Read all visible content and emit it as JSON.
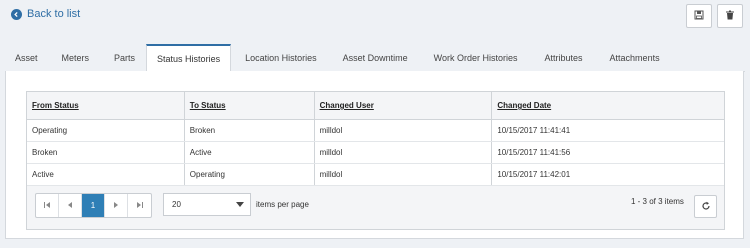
{
  "back_link": {
    "label": "Back to list"
  },
  "tabs": [
    {
      "label": "Asset"
    },
    {
      "label": "Meters"
    },
    {
      "label": "Parts"
    },
    {
      "label": "Status Histories"
    },
    {
      "label": "Location Histories"
    },
    {
      "label": "Asset Downtime"
    },
    {
      "label": "Work Order Histories"
    },
    {
      "label": "Attributes"
    },
    {
      "label": "Attachments"
    }
  ],
  "active_tab": "Status Histories",
  "table": {
    "headers": [
      "From Status",
      "To Status",
      "Changed User",
      "Changed Date"
    ],
    "rows": [
      [
        "Operating",
        "Broken",
        "milldol",
        "10/15/2017 11:41:41"
      ],
      [
        "Broken",
        "Active",
        "milldol",
        "10/15/2017 11:41:56"
      ],
      [
        "Active",
        "Operating",
        "milldol",
        "10/15/2017 11:42:01"
      ]
    ]
  },
  "pager": {
    "current_page": "1",
    "page_size": "20",
    "page_size_label": "items per page",
    "info": "1 - 3 of 3 items"
  },
  "icons": {
    "back": "circle-arrow-left-icon",
    "save": "floppy-disk-icon",
    "delete": "trash-icon",
    "first": "first-page-icon",
    "prev": "prev-page-icon",
    "next": "next-page-icon",
    "last": "last-page-icon",
    "refresh": "refresh-icon"
  },
  "colors": {
    "accent": "#2f6ea5",
    "page_active": "#2f7fb6"
  }
}
